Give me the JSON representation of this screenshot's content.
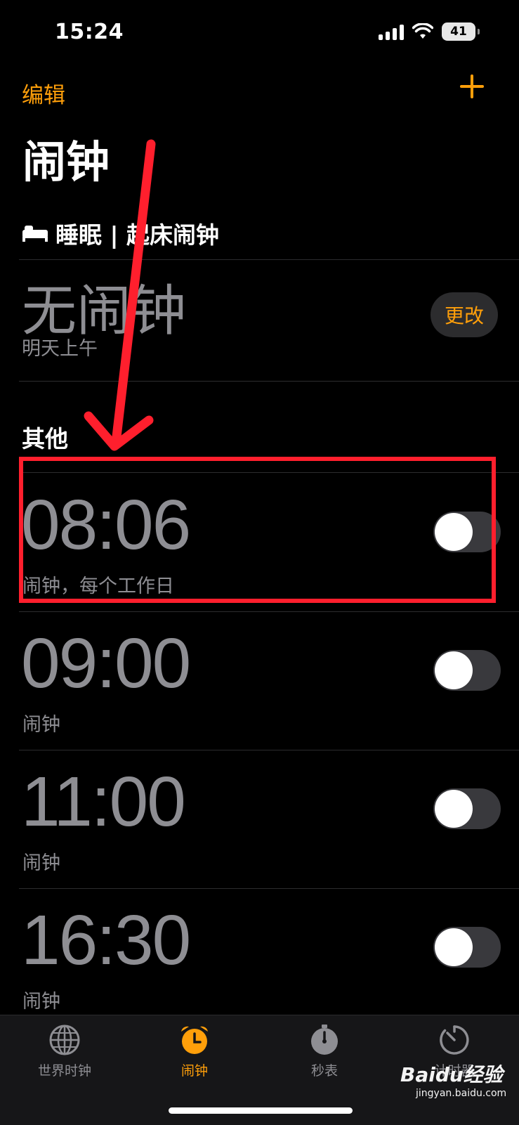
{
  "status_bar": {
    "time": "15:24",
    "battery": "41"
  },
  "nav": {
    "edit_label": "编辑",
    "title": "闹钟"
  },
  "sleep": {
    "section_title": "睡眠 | 起床闹钟",
    "no_alarm": "无闹钟",
    "subtitle": "明天上午",
    "change_label": "更改"
  },
  "other": {
    "section_title": "其他"
  },
  "alarms": [
    {
      "time": "08:06",
      "label": "闹钟，每个工作日",
      "enabled": false
    },
    {
      "time": "09:00",
      "label": "闹钟",
      "enabled": false
    },
    {
      "time": "11:00",
      "label": "闹钟",
      "enabled": false
    },
    {
      "time": "16:30",
      "label": "闹钟",
      "enabled": false
    }
  ],
  "tabs": [
    {
      "label": "世界时钟",
      "icon": "globe-icon",
      "active": false
    },
    {
      "label": "闹钟",
      "icon": "alarm-clock-icon",
      "active": true
    },
    {
      "label": "秒表",
      "icon": "stopwatch-icon",
      "active": false
    },
    {
      "label": "计时器",
      "icon": "timer-icon",
      "active": false
    }
  ],
  "watermark": {
    "brand": "Baidu经验",
    "url": "jingyan.baidu.com"
  },
  "colors": {
    "accent": "#ff9f0a",
    "highlight": "#ff1f2d",
    "background": "#000000"
  }
}
